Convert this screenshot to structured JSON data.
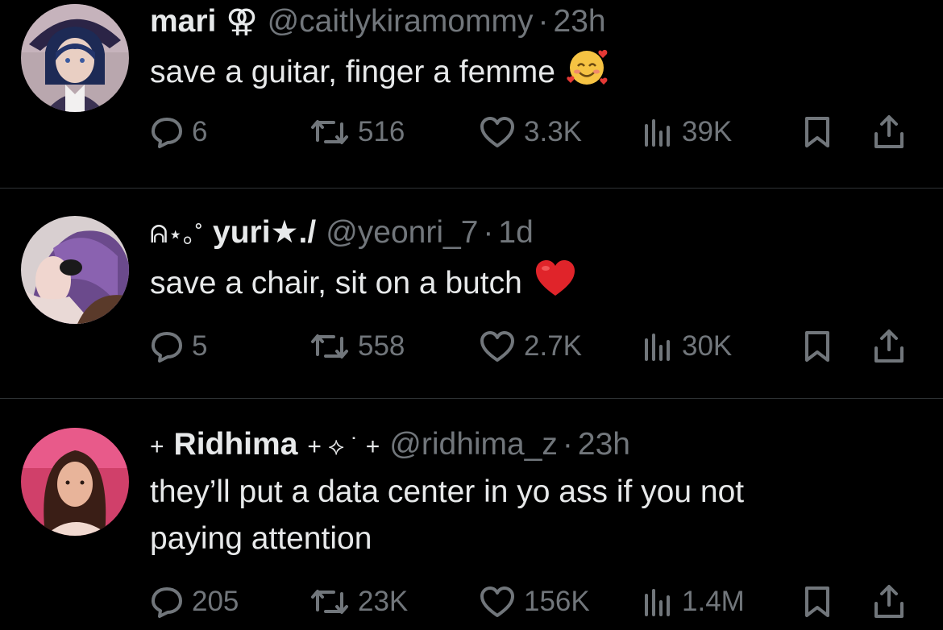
{
  "posts": [
    {
      "name": "mari",
      "name_symbol": "⚢",
      "handle": "@caitlykiramommy",
      "separator": "·",
      "time": "23h",
      "text": "save a guitar, finger a femme",
      "emoji": "smiling-face-with-hearts",
      "replies": "6",
      "reposts": "516",
      "likes": "3.3K",
      "views": "39K"
    },
    {
      "name_prefix": "ᕱ⋆｡˚",
      "name": "yuri★./",
      "handle": "@yeonri_7",
      "separator": "·",
      "time": "1d",
      "text": "save a chair, sit on a butch",
      "emoji": "red-heart",
      "replies": "5",
      "reposts": "558",
      "likes": "2.7K",
      "views": "30K"
    },
    {
      "name_prefix": "+",
      "name": "Ridhima",
      "name_suffix": "+ ⟡ ˙ +",
      "handle": "@ridhima_z",
      "separator": "·",
      "time": "23h",
      "text": "they’ll put a data center in yo ass if you not\npaying attention",
      "replies": "205",
      "reposts": "23K",
      "likes": "156K",
      "views": "1.4M"
    }
  ],
  "colors": {
    "background": "#000000",
    "text": "#e7e9ea",
    "muted": "#71767b",
    "divider": "#2f3336"
  }
}
